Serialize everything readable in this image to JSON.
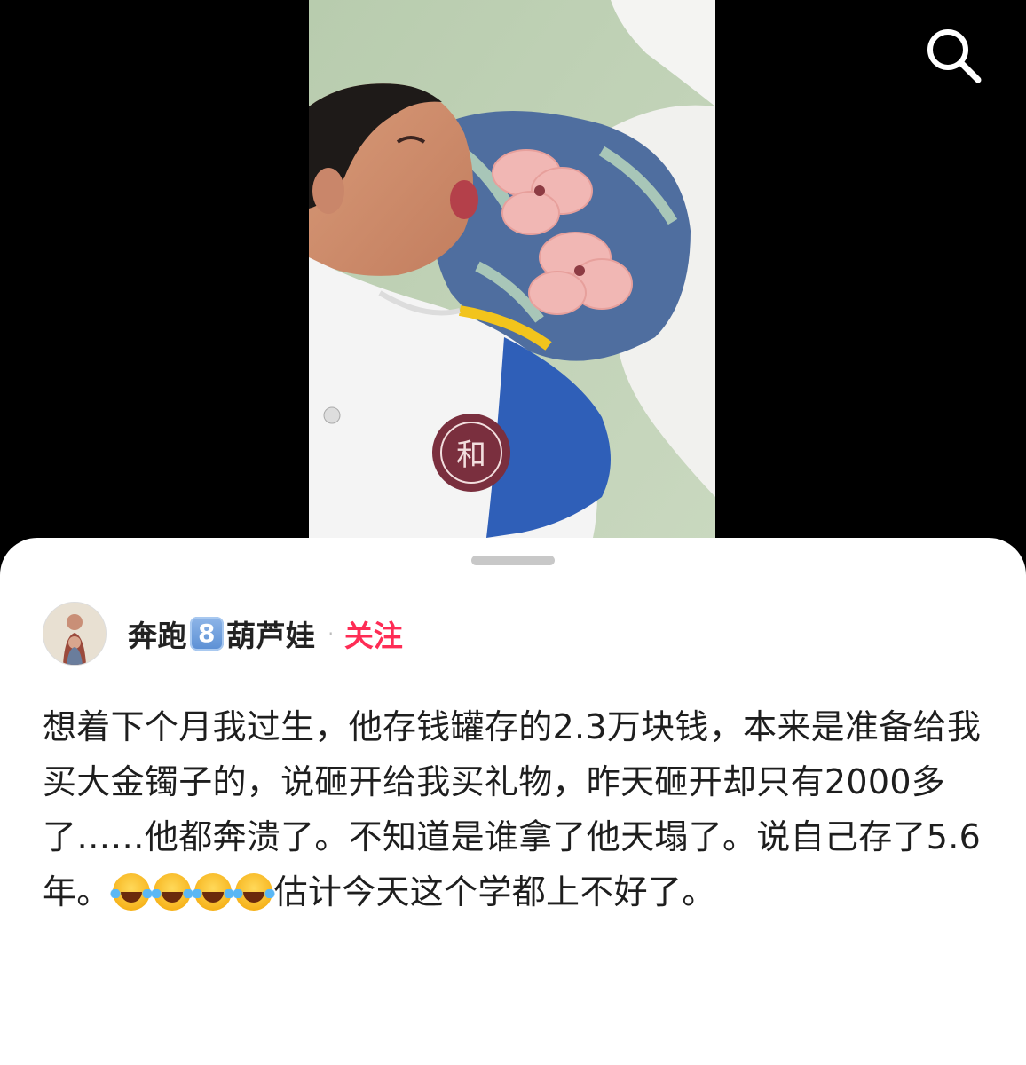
{
  "icons": {
    "search": "search-icon"
  },
  "author": {
    "name_part1": "奔跑",
    "name_keycap": "8",
    "name_part2": "葫芦娃",
    "separator": "·",
    "follow_label": "关注"
  },
  "post": {
    "text_before_emoji": "想着下个月我过生，他存钱罐存的2.3万块钱，本来是准备给我买大金镯子的，说砸开给我买礼物，昨天砸开却只有2000多了……他都奔溃了。不知道是谁拿了他天塌了。说自己存了5.6年。",
    "emoji": "face-with-tears-of-joy",
    "emoji_count": 4,
    "text_after_emoji": "估计今天这个学都上不好了。"
  },
  "colors": {
    "follow": "#fe2c55",
    "background": "#000000",
    "sheet": "#ffffff"
  }
}
